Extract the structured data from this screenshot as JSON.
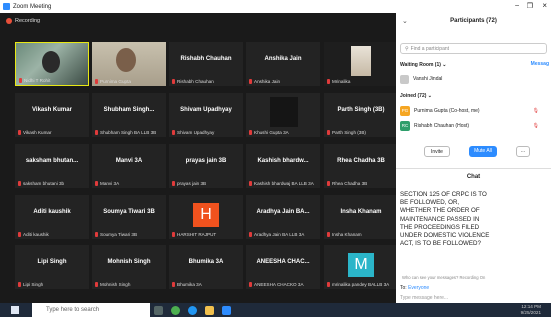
{
  "window": {
    "title": "Zoom Meeting",
    "recording": "Recording"
  },
  "tiles": [
    {
      "label": "Nidhi T Rohit",
      "mode": "photo1"
    },
    {
      "label": "Purnima Gupta",
      "mode": "photo2"
    },
    {
      "name": "Rishabh Chauhan",
      "label": "Rishabh Chauhan"
    },
    {
      "name": "Anshika Jain",
      "label": "Anshika Jain"
    },
    {
      "label": "Mrinalika",
      "mode": "photo3"
    },
    {
      "name": "Vikash Kumar",
      "label": "Vikash Kumar"
    },
    {
      "name": "Shubham Singh...",
      "label": "Shubham Singh BA LLB 3B"
    },
    {
      "name": "Shivam Upadhyay",
      "label": "Shivam Upadhyay"
    },
    {
      "label": "Khushi Gupta 3A",
      "mode": "dark"
    },
    {
      "name": "Parth Singh (3B)",
      "label": "Parth Singh (3B)"
    },
    {
      "name": "saksham bhutan...",
      "label": "saksham bhutani 3b"
    },
    {
      "name": "Manvi 3A",
      "label": "Manvi 3A"
    },
    {
      "name": "prayas jain 3B",
      "label": "prayas jain 3B"
    },
    {
      "name": "Kashish bhardw...",
      "label": "Kashish bhardwaj BA LLB 3A"
    },
    {
      "name": "Rhea Chadha 3B",
      "label": "Rhea Chadha 3B"
    },
    {
      "name": "Aditi kaushik",
      "label": "Aditi kaushik"
    },
    {
      "name": "Soumya Tiwari 3B",
      "label": "Soumya Tiwari 3B"
    },
    {
      "label": "HARSHIT RAJPUT",
      "mode": "avatarH",
      "initial": "H"
    },
    {
      "name": "Aradhya Jain BA...",
      "label": "Aradhya Jain BA LLB 3A"
    },
    {
      "name": "Insha Khanam",
      "label": "Insha Khanam"
    },
    {
      "name": "Lipi Singh",
      "label": "Lipi Singh"
    },
    {
      "name": "Mohnish Singh",
      "label": "Mohnish Singh"
    },
    {
      "name": "Bhumika 3A",
      "label": "Bhumika 3A"
    },
    {
      "name": "ANEESHA CHAC...",
      "label": "ANEESHA CHACKO 3A"
    },
    {
      "label": "mrinalika pandey BALLB 3A",
      "mode": "avatarM",
      "initial": "M"
    }
  ],
  "panel": {
    "participants_title": "Participants (72)",
    "find_placeholder": "Find a participant",
    "waiting_room": "Waiting Room (1)",
    "message": "Messag",
    "waiting_user": "Vanshi Jindal",
    "joined": "Joined (72)",
    "p1_initials": "PG",
    "p1": "Purnima Gupta (Co-host, me)",
    "p2_initials": "RC",
    "p2": "Rishabh Chauhan (Host)",
    "invite": "Invite",
    "mute_all": "Mute All",
    "more": "...",
    "chat_title": "Chat",
    "chat_message": "SECTION 125 OF CRPC IS TO BE FOLLOWED, OR, WHETHER THE ORDER OF MAINTENANCE PASSED IN THE PROCEEDINGS FILED UNDER DOMESTIC VIOLENCE ACT, IS TO BE FOLLOWED?",
    "who_can_see": "Who can see your messages? Recording On",
    "to": "To:",
    "everyone": "Everyone",
    "type_placeholder": "Type message here..."
  },
  "taskbar": {
    "search": "Type here to search",
    "time": "12:14 PM",
    "date": "9/25/2021"
  },
  "colors": {
    "hAvatar": "#f0521e",
    "mAvatar": "#2bb5c9",
    "pg": "#f5a623",
    "rc": "#2e9e6b",
    "mute": "#2d8cff"
  }
}
